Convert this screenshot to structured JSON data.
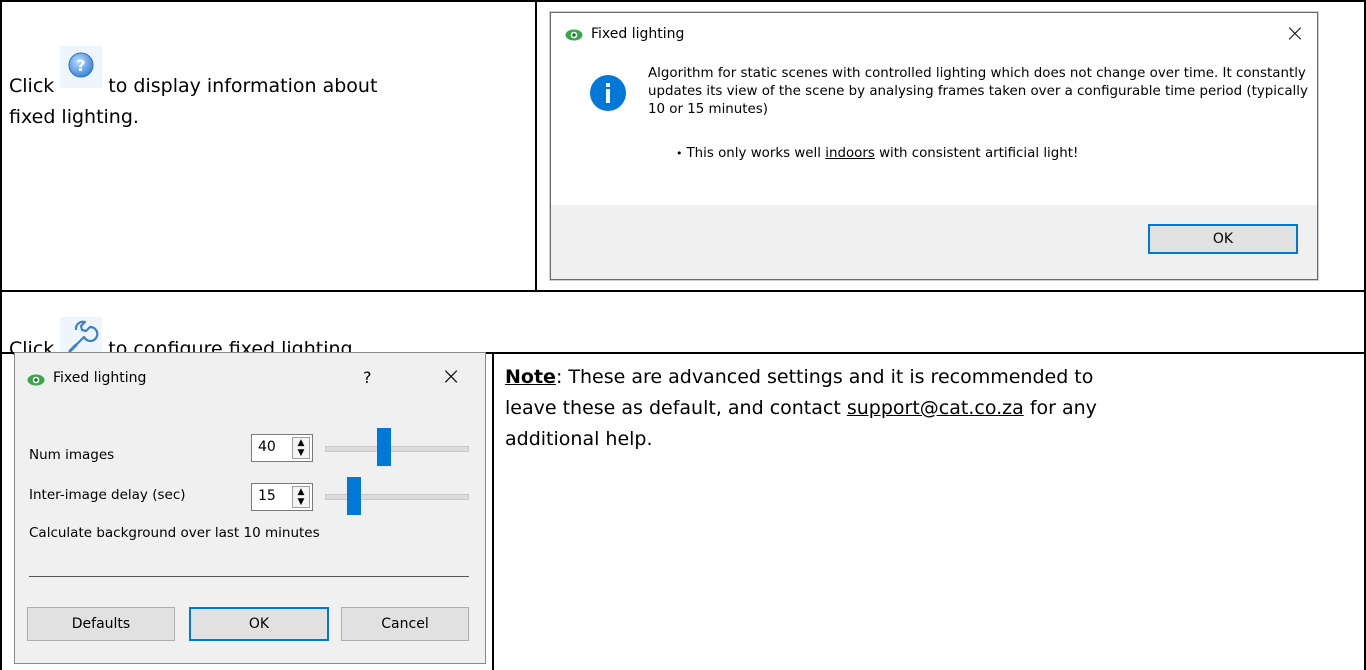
{
  "row1": {
    "text_before": "Click",
    "text_after": "to display information about",
    "text_line2": "fixed lighting.",
    "icon": "help-question-icon"
  },
  "info_dialog": {
    "title": "Fixed lighting",
    "close": "×",
    "message": "Algorithm for static scenes with controlled lighting which does not change over time. It constantly updates its view of the scene by analysing frames taken over a configurable time period (typically 10 or 15 minutes)",
    "bullet": "•",
    "bullet_pre": "This only works well",
    "bullet_link": "indoors",
    "bullet_post": "with consistent artificial light!",
    "ok_label": "OK",
    "info_icon": "info-icon",
    "accent": "#0078d7"
  },
  "row2": {
    "text_before": "Click",
    "text_after": "to configure fixed lighting.",
    "icon": "wrench-icon"
  },
  "config_dialog": {
    "title": "Fixed lighting",
    "help": "?",
    "close": "×",
    "num_images_label": "Num images",
    "num_images_value": "40",
    "delay_label": "Inter-image delay (sec)",
    "delay_value": "15",
    "info_text": "Calculate background over last 10 minutes",
    "defaults_label": "Defaults",
    "ok_label": "OK",
    "cancel_label": "Cancel"
  },
  "note": {
    "bold": "Note",
    "text1": ": These are advanced settings and it is recommended to",
    "text2": "leave these as default, and contact",
    "email": "support@cat.co.za",
    "text3": "for any",
    "text4": "additional help."
  }
}
